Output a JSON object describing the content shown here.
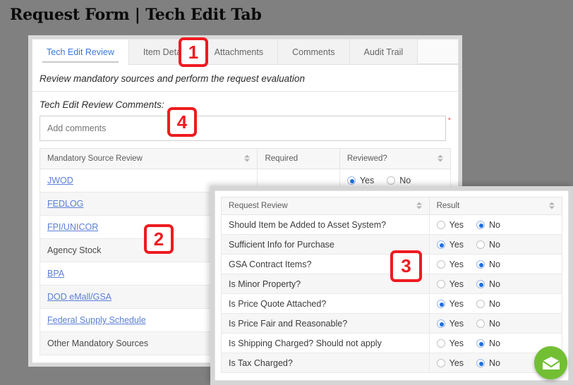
{
  "page_title": "Request Form | Tech Edit Tab",
  "tech_edit_panel": {
    "tabs": [
      {
        "label": "Tech Edit Review",
        "active": true
      },
      {
        "label": "Item Detail",
        "active": false
      },
      {
        "label": "Attachments",
        "active": false
      },
      {
        "label": "Comments",
        "active": false
      },
      {
        "label": "Audit Trail",
        "active": false
      }
    ],
    "subtitle": "Review mandatory sources and perform the request evaluation",
    "comments_label": "Tech Edit Review Comments:",
    "comments_placeholder": "Add comments",
    "comments_value": "",
    "required_marker": "*",
    "table": {
      "headers": [
        {
          "label": "Mandatory Source Review",
          "sortable": true
        },
        {
          "label": "Required",
          "sortable": false
        },
        {
          "label": "Reviewed?",
          "sortable": true
        }
      ],
      "rows": [
        {
          "source": "JWOD",
          "is_link": true,
          "required": "",
          "reviewed": "Yes"
        },
        {
          "source": "FEDLOG",
          "is_link": true,
          "required": "",
          "reviewed": ""
        },
        {
          "source": "FPI/UNICOR",
          "is_link": true,
          "required": "",
          "reviewed": ""
        },
        {
          "source": "Agency Stock",
          "is_link": false,
          "required": "",
          "reviewed": ""
        },
        {
          "source": "BPA",
          "is_link": true,
          "required": "",
          "reviewed": ""
        },
        {
          "source": "DOD eMall/GSA",
          "is_link": true,
          "required": "",
          "reviewed": ""
        },
        {
          "source": "Federal Supply Schedule",
          "is_link": true,
          "required": "",
          "reviewed": ""
        },
        {
          "source": "Other Mandatory Sources",
          "is_link": false,
          "required": "",
          "reviewed": ""
        }
      ],
      "radio_yes_label": "Yes",
      "radio_no_label": "No"
    }
  },
  "request_review_panel": {
    "headers": [
      {
        "label": "Request Review",
        "sortable": true
      },
      {
        "label": "Result",
        "sortable": true
      }
    ],
    "radio_yes_label": "Yes",
    "radio_no_label": "No",
    "rows": [
      {
        "question": "Should Item be Added to Asset System?",
        "result": "No"
      },
      {
        "question": "Sufficient Info for Purchase",
        "result": "Yes"
      },
      {
        "question": "GSA Contract Items?",
        "result": "No"
      },
      {
        "question": "Is Minor Property?",
        "result": "No"
      },
      {
        "question": "Is Price Quote Attached?",
        "result": "Yes"
      },
      {
        "question": "Is Price Fair and Reasonable?",
        "result": "Yes"
      },
      {
        "question": "Is Shipping Charged? Should not apply",
        "result": "No"
      },
      {
        "question": "Is Tax Charged?",
        "result": "No"
      }
    ]
  },
  "help_widget": {
    "icon": "envelope-icon",
    "color": "#72bf34"
  },
  "markers": [
    {
      "id": "1",
      "label": "1"
    },
    {
      "id": "2",
      "label": "2"
    },
    {
      "id": "3",
      "label": "3"
    },
    {
      "id": "4",
      "label": "4"
    }
  ],
  "colors": {
    "background": "#808080",
    "accent_blue": "#3a7bd5",
    "link_blue": "#5a7fd6",
    "radio_blue": "#1f6fe0",
    "marker_red": "#ee1b20",
    "required_red": "#ef5b5b",
    "envelope_green": "#72bf34"
  }
}
